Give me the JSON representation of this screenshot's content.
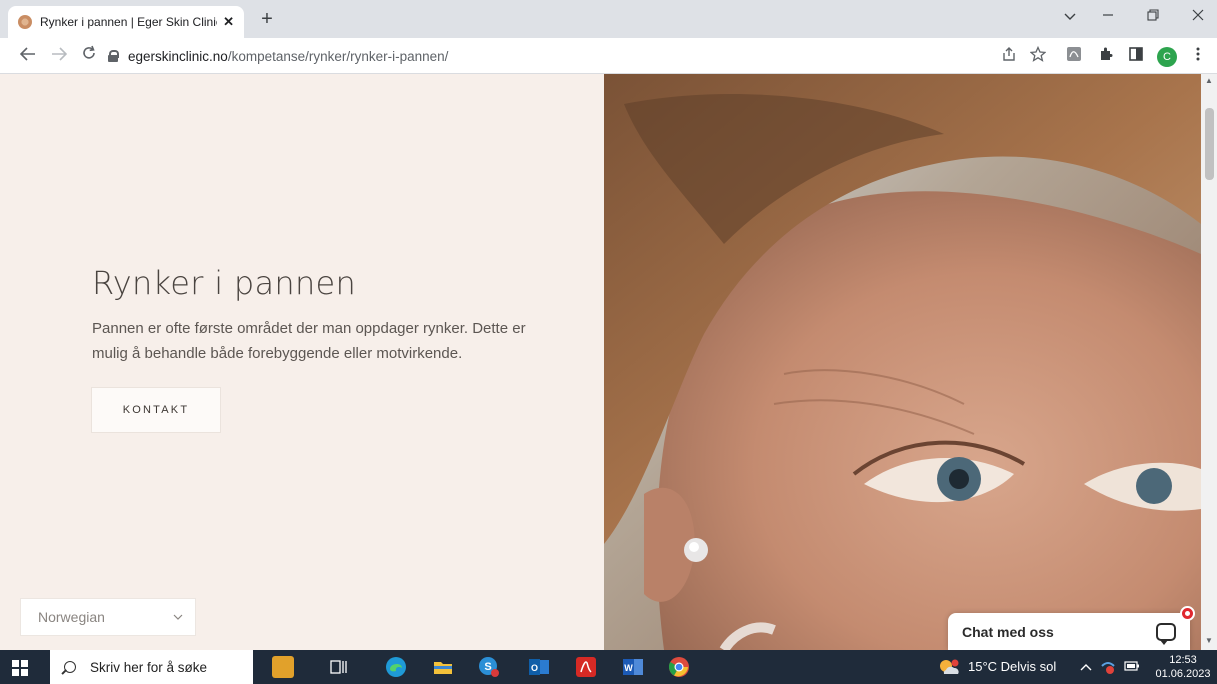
{
  "browser": {
    "tab_title": "Rynker i pannen | Eger Skin Clinic",
    "tab_close": "✕",
    "new_tab": "+",
    "url_host": "egerskinclinic.no",
    "url_path": "/kompetanse/rynker/rynker-i-pannen/",
    "profile_initial": "C"
  },
  "page": {
    "title": "Rynker i pannen",
    "intro": "Pannen er ofte første området der man oppdager rynker. Dette er mulig å behandle både forebyggende eller motvirkende.",
    "contact_button": "KONTAKT",
    "language": "Norwegian",
    "chat_label": "Chat med oss"
  },
  "taskbar": {
    "search_placeholder": "Skriv her for å søke",
    "weather": "15°C  Delvis sol",
    "time": "12:53",
    "date": "01.06.2023"
  },
  "colors": {
    "page_bg": "#f7efea",
    "taskbar_bg": "#1f2b3a",
    "chat_badge": "#e0282f"
  }
}
